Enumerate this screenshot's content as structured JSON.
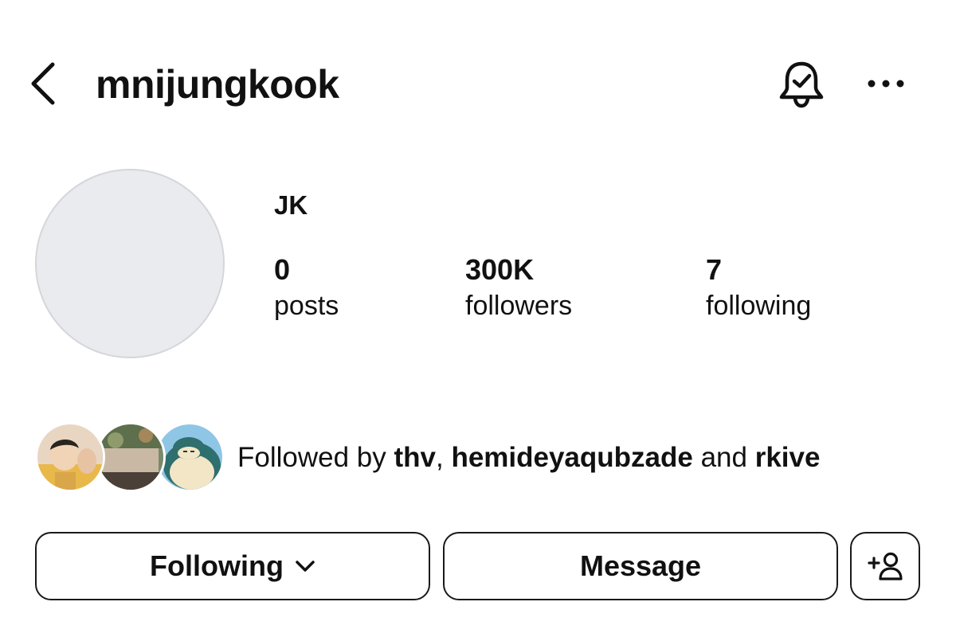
{
  "header": {
    "username": "mnijungkook",
    "icons": {
      "back": "chevron-left-icon",
      "notifications": "bell-check-icon",
      "more": "more-horizontal-icon"
    }
  },
  "profile": {
    "display_name": "JK",
    "stats": [
      {
        "value": "0",
        "label": "posts"
      },
      {
        "value": "300K",
        "label": "followers"
      },
      {
        "value": "7",
        "label": "following"
      }
    ]
  },
  "followed_by": {
    "prefix": "Followed by ",
    "users": [
      "thv",
      "hemideyaqubzade",
      "rkive"
    ],
    "separator": ", ",
    "conjunction": " and "
  },
  "actions": {
    "following_label": "Following",
    "message_label": "Message",
    "add_user_icon": "person-plus-icon"
  },
  "colors": {
    "text": "#111111",
    "avatar_placeholder": "#e9ebef",
    "border": "#1a1a1a"
  }
}
